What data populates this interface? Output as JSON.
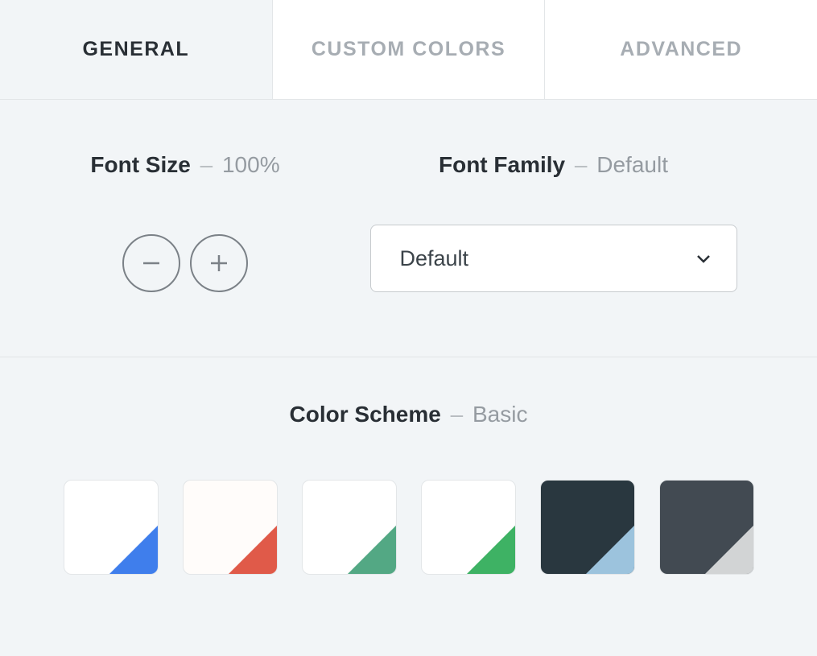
{
  "tabs": {
    "general": "General",
    "custom_colors": "Custom Colors",
    "advanced": "Advanced",
    "active": "general"
  },
  "font_size": {
    "label": "Font Size",
    "dash": "–",
    "value": "100%"
  },
  "font_family": {
    "label": "Font Family",
    "dash": "–",
    "value": "Default",
    "selected": "Default"
  },
  "color_scheme": {
    "label": "Color Scheme",
    "dash": "–",
    "value": "Basic"
  },
  "swatches": [
    {
      "name": "light-blue",
      "bg": "#ffffff",
      "accent": "#3f7eec"
    },
    {
      "name": "light-red",
      "bg": "#fffcfa",
      "accent": "#e05a49"
    },
    {
      "name": "light-teal",
      "bg": "#ffffff",
      "accent": "#53a884"
    },
    {
      "name": "light-green",
      "bg": "#ffffff",
      "accent": "#3eb264"
    },
    {
      "name": "dark-blue",
      "bg": "#29373f",
      "accent": "#9cc3dd"
    },
    {
      "name": "dark-gray",
      "bg": "#424a52",
      "accent": "#d2d4d5"
    }
  ]
}
